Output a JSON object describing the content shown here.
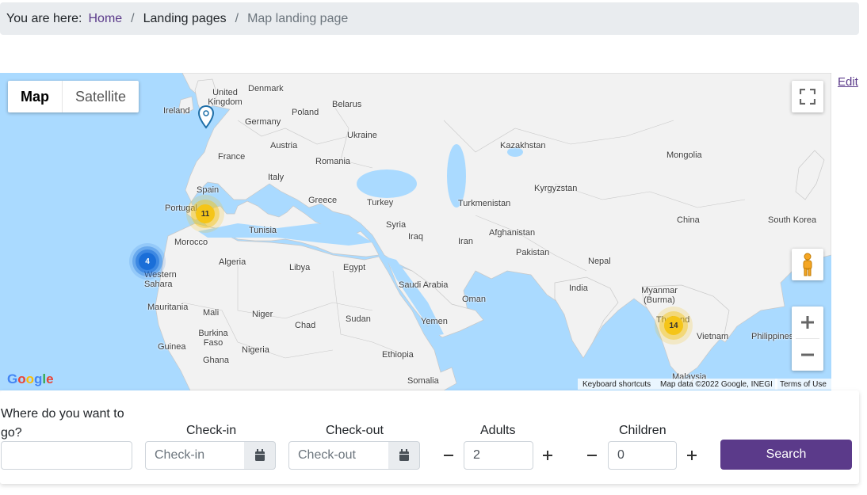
{
  "breadcrumb": {
    "lead": "You are here:",
    "items": [
      {
        "label": "Home",
        "link": true
      },
      {
        "label": "Landing pages",
        "link": false
      },
      {
        "label": "Map landing page",
        "link": false
      }
    ],
    "separator": "/"
  },
  "edit_label": "Edit",
  "map": {
    "type_controls": {
      "map": "Map",
      "satellite": "Satellite"
    },
    "clusters": [
      {
        "count": "11",
        "color": "yellow"
      },
      {
        "count": "4",
        "color": "blue"
      },
      {
        "count": "14",
        "color": "yellow"
      }
    ],
    "country_labels": [
      "Denmark",
      "United Kingdom",
      "Ireland",
      "Belarus",
      "Poland",
      "Germany",
      "Ukraine",
      "France",
      "Austria",
      "Romania",
      "Kazakhstan",
      "Mongolia",
      "Italy",
      "Spain",
      "Portugal",
      "Greece",
      "Turkey",
      "Kyrgyzstan",
      "Turkmenistan",
      "Tunisia",
      "Syria",
      "Iraq",
      "Afghanistan",
      "China",
      "South Korea",
      "Morocco",
      "Algeria",
      "Libya",
      "Egypt",
      "Iran",
      "Pakistan",
      "Nepal",
      "Western Sahara",
      "Saudi Arabia",
      "Oman",
      "India",
      "Myanmar (Burma)",
      "Mauritania",
      "Mali",
      "Niger",
      "Chad",
      "Sudan",
      "Yemen",
      "Thailand",
      "Vietnam",
      "Philippines",
      "Burkina Faso",
      "Nigeria",
      "Guinea",
      "Ghana",
      "Ethiopia",
      "Somalia",
      "Malaysia"
    ],
    "logo": "Google",
    "attribution": {
      "shortcuts": "Keyboard shortcuts",
      "data": "Map data ©2022 Google, INEGI",
      "terms": "Terms of Use"
    }
  },
  "form": {
    "destination_label": "Where do you want to go?",
    "destination_value": "",
    "checkin_label": "Check-in",
    "checkin_placeholder": "Check-in",
    "checkout_label": "Check-out",
    "checkout_placeholder": "Check-out",
    "adults_label": "Adults",
    "adults_value": "2",
    "children_label": "Children",
    "children_value": "0",
    "search_label": "Search"
  },
  "colors": {
    "accent": "#5b3a8a",
    "water": "#aadaff",
    "land": "#f2f2f2"
  }
}
